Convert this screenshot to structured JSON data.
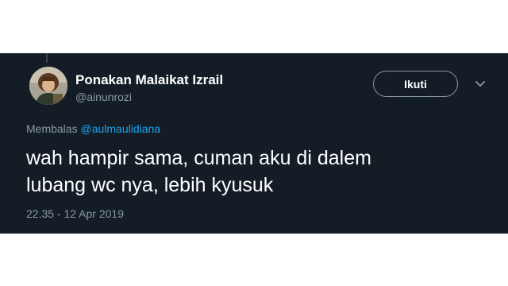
{
  "tweet": {
    "author": {
      "display_name": "Ponakan Malaikat Izrail",
      "handle": "@ainunrozi",
      "avatar_icon": "profile-photo"
    },
    "follow_label": "Ikuti",
    "menu_icon": "chevron-down-icon",
    "reply": {
      "prefix": "Membalas",
      "mention": "@aulmaulidiana"
    },
    "text_lines": [
      "wah hampir sama, cuman aku di dalem",
      "lubang wc nya, lebih kyusuk"
    ],
    "timestamp": "22.35 - 12 Apr 2019"
  },
  "colors": {
    "background": "#141d26",
    "text": "#ffffff",
    "muted": "#8899a6",
    "link": "#1da1f2"
  }
}
